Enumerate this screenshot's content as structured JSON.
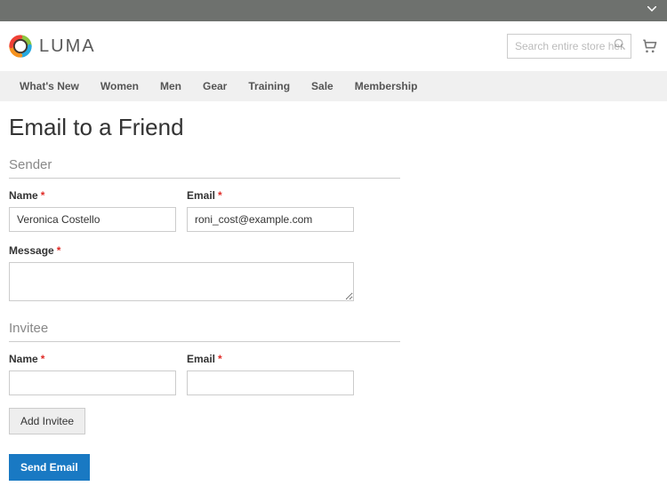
{
  "topbar": {},
  "header": {
    "logo_text": "LUMA",
    "search_placeholder": "Search entire store here..."
  },
  "nav": {
    "items": [
      {
        "label": "What's New"
      },
      {
        "label": "Women"
      },
      {
        "label": "Men"
      },
      {
        "label": "Gear"
      },
      {
        "label": "Training"
      },
      {
        "label": "Sale"
      },
      {
        "label": "Membership"
      }
    ]
  },
  "page": {
    "title": "Email to a Friend"
  },
  "form": {
    "sender": {
      "legend": "Sender",
      "name_label": "Name",
      "name_value": "Veronica Costello",
      "email_label": "Email",
      "email_value": "roni_cost@example.com",
      "message_label": "Message",
      "message_value": ""
    },
    "invitee": {
      "legend": "Invitee",
      "name_label": "Name",
      "name_value": "",
      "email_label": "Email",
      "email_value": ""
    },
    "add_invitee_label": "Add Invitee",
    "submit_label": "Send Email"
  }
}
